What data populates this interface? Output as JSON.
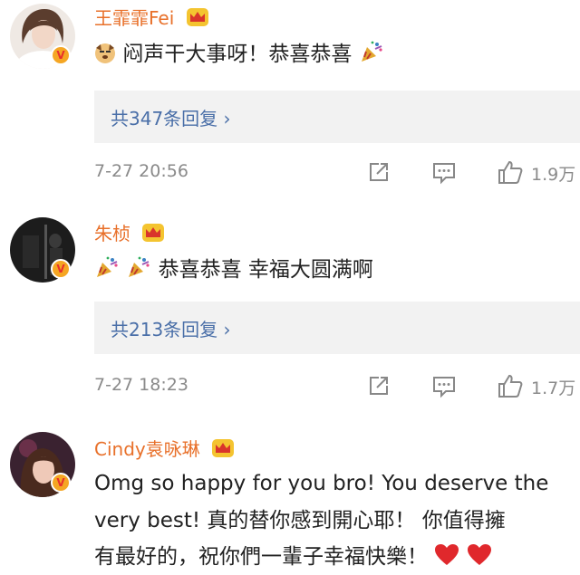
{
  "comments": [
    {
      "author": "王霏霏Fei",
      "text": "闷声干大事呀！恭喜恭喜",
      "reply_link": "共347条回复 ›",
      "time": "7-27 20:56",
      "likes": "1.9万"
    },
    {
      "author": "朱桢",
      "text": "恭喜恭喜 幸福大圆满啊",
      "reply_link": "共213条回复 ›",
      "time": "7-27 18:23",
      "likes": "1.7万"
    },
    {
      "author": "Cindy袁咏琳",
      "text_line1": "Omg so happy for you bro! You deserve the",
      "text_line2": "very best! 真的替你感到開心耶！ 你值得擁",
      "text_line3": "有最好的，祝你們一輩子幸福快樂！"
    }
  ],
  "colors": {
    "name": "#e8702a",
    "link": "#4a6fa8",
    "meta": "#8a8a8a",
    "reply_bg": "#f2f2f2",
    "heart": "#e0282c"
  },
  "icons": [
    "crown-icon",
    "verified-badge-icon",
    "share-icon",
    "comment-icon",
    "like-icon",
    "party-popper-icon",
    "dog-emoji-icon",
    "heart-icon"
  ]
}
